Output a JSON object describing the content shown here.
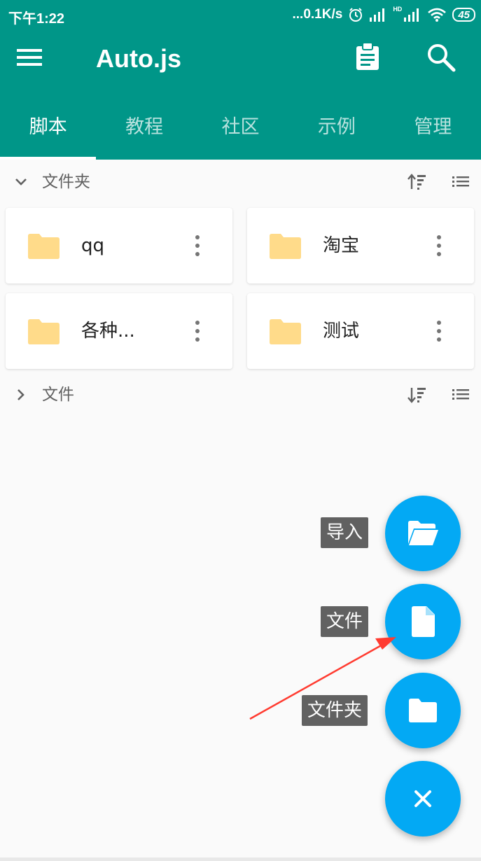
{
  "status_bar": {
    "time": "下午1:22",
    "speed": "...0.1K/s",
    "network": "HD",
    "battery": "45"
  },
  "app_bar": {
    "title": "Auto.js"
  },
  "tabs": [
    {
      "label": "脚本",
      "active": true
    },
    {
      "label": "教程",
      "active": false
    },
    {
      "label": "社区",
      "active": false
    },
    {
      "label": "示例",
      "active": false
    },
    {
      "label": "管理",
      "active": false
    }
  ],
  "folders_section": {
    "label": "文件夹",
    "expanded": true
  },
  "folders": [
    {
      "name": "qq"
    },
    {
      "name": "淘宝"
    },
    {
      "name": "各种..."
    },
    {
      "name": "测试"
    }
  ],
  "files_section": {
    "label": "文件",
    "expanded": false
  },
  "fab_menu": {
    "import_label": "导入",
    "file_label": "文件",
    "folder_label": "文件夹",
    "close_icon": "close-icon"
  },
  "colors": {
    "primary": "#009688",
    "accent": "#03a9f4",
    "folder": "#ffdb8a",
    "arrow": "#ff3b30"
  }
}
